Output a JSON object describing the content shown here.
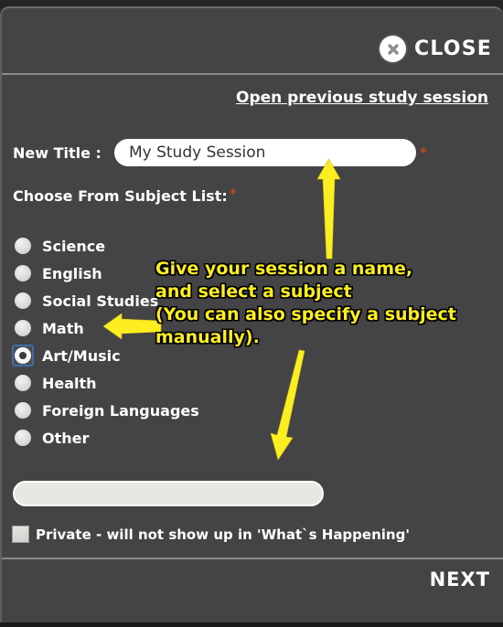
{
  "dialog": {
    "close_label": "CLOSE",
    "close_icon": "close-x-circle-icon",
    "prev_session_link": "Open previous study session",
    "next_label": "NEXT"
  },
  "form": {
    "title_label": "New Title :",
    "title_value": "My Study Session",
    "title_placeholder": "",
    "title_required_marker": "*",
    "subject_heading": "Choose From Subject List:",
    "subject_required_marker": "*",
    "subjects": [
      {
        "label": "Science",
        "selected": false
      },
      {
        "label": "English",
        "selected": false
      },
      {
        "label": "Social Studies",
        "selected": false
      },
      {
        "label": "Math",
        "selected": false
      },
      {
        "label": "Art/Music",
        "selected": true
      },
      {
        "label": "Health",
        "selected": false
      },
      {
        "label": "Foreign Languages",
        "selected": false
      },
      {
        "label": "Other",
        "selected": false
      }
    ],
    "other_subject_value": "",
    "other_subject_placeholder": "",
    "private_label": "Private - will not show up in 'What`s Happening'",
    "private_checked": false
  },
  "annotation": {
    "text": "Give your session a name,\nand select a subject\n(You can also specify a subject\nmanually).",
    "color": "#fcee21",
    "outline_color": "#000000",
    "arrows": [
      {
        "name": "arrow-to-title-input",
        "direction": "up"
      },
      {
        "name": "arrow-to-subject-radio",
        "direction": "left"
      },
      {
        "name": "arrow-to-other-input",
        "direction": "down"
      }
    ]
  },
  "colors": {
    "panel_bg": "#444446",
    "divider": "#8a8a8c",
    "text": "#ffffff",
    "required": "#bf4a1e",
    "selection_ring": "#3f6fa8",
    "input_bg": "#ffffff",
    "secondary_input_bg": "#e8e8e2"
  }
}
